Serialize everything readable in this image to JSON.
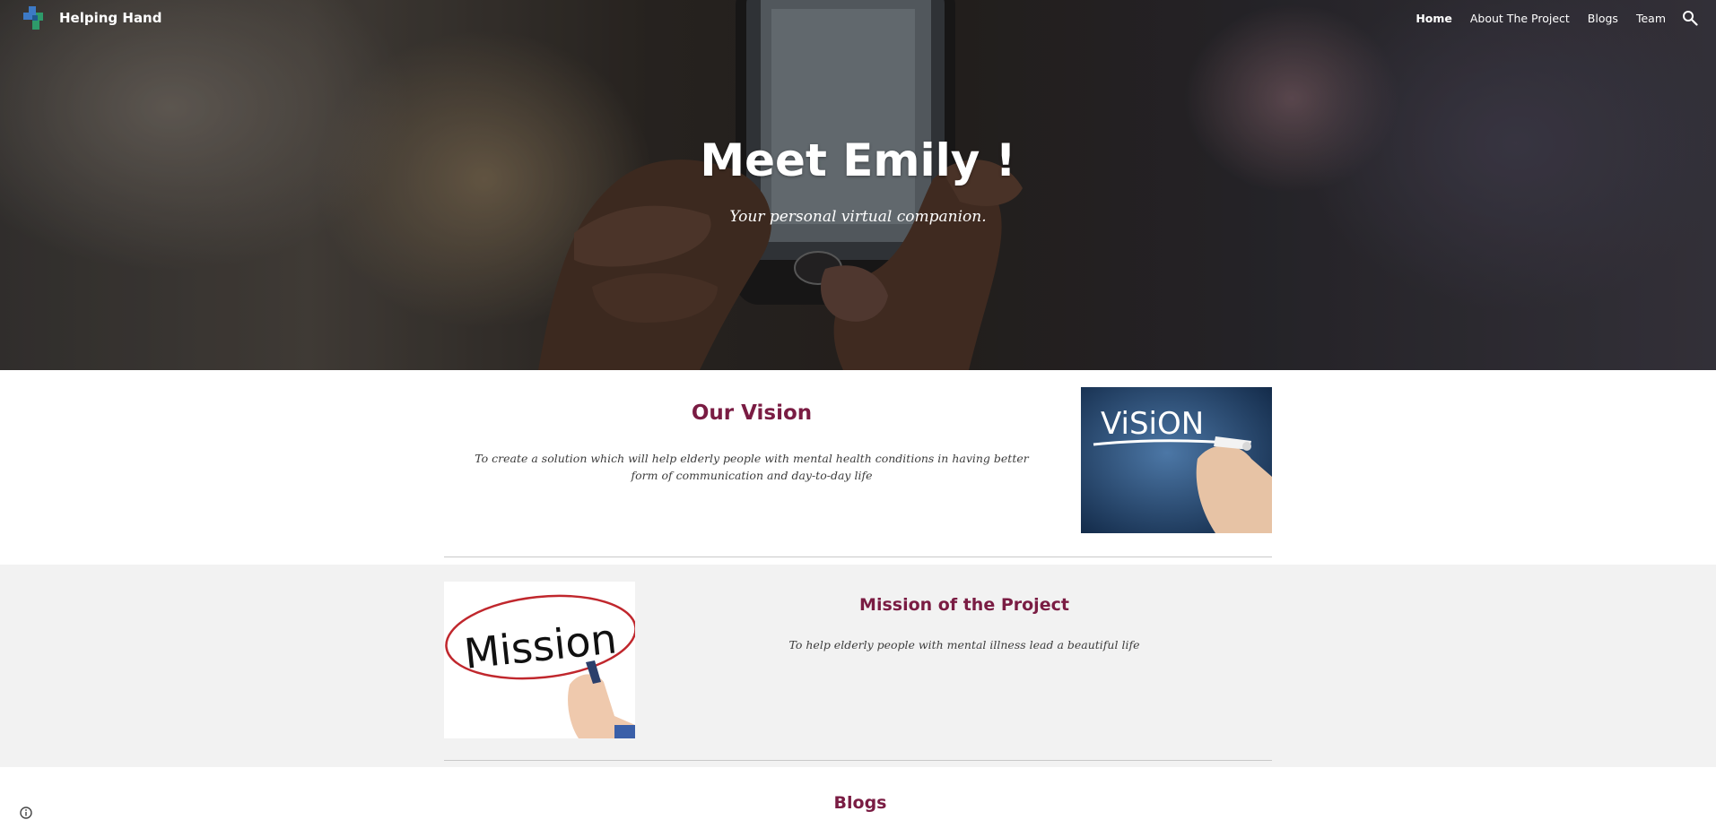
{
  "site": {
    "name": "Helping Hand"
  },
  "nav": {
    "items": [
      {
        "label": "Home",
        "active": true
      },
      {
        "label": "About The Project",
        "active": false
      },
      {
        "label": "Blogs",
        "active": false
      },
      {
        "label": "Team",
        "active": false
      }
    ],
    "search_icon": "search-icon"
  },
  "hero": {
    "title": "Meet Emily !",
    "subtitle": "Your personal virtual companion."
  },
  "vision": {
    "heading": "Our Vision",
    "text": "To create a solution which will help elderly people with mental health conditions  in having better form of communication and day-to-day life",
    "image_text": "ViSiON"
  },
  "mission": {
    "heading": "Mission of the Project",
    "text": "To help elderly people with mental illness lead a beautiful life",
    "image_text": "Mission"
  },
  "blogs": {
    "heading": "Blogs"
  },
  "colors": {
    "heading": "#7a1c43",
    "nav_text": "#ffffff",
    "alt_section_bg": "#f2f2f2"
  }
}
